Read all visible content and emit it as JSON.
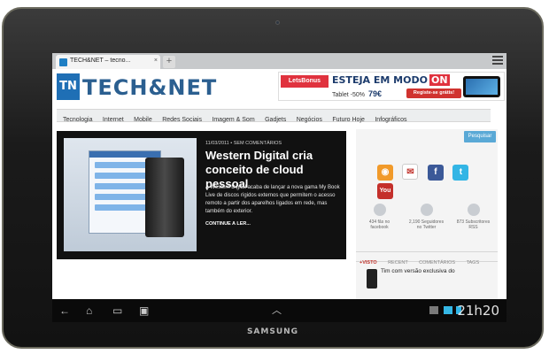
{
  "device": {
    "brand": "SAMSUNG"
  },
  "browser": {
    "tab_title": "TECH&NET – tecno...",
    "tab_close": "×",
    "new_tab": "+"
  },
  "site": {
    "logo_mark": "TN",
    "logo_text": "TECH&NET",
    "ad": {
      "brand": "LetsBonus",
      "headline": "ESTEJA EM MODO",
      "headline_highlight": "ON",
      "offer": "Tablet -50%",
      "price": "79€",
      "cta": "Registe-se grátis!"
    },
    "nav": [
      "Tecnologia",
      "Internet",
      "Mobile",
      "Redes Sociais",
      "Imagem & Som",
      "Gadjets",
      "Negócios",
      "Futuro Hoje",
      "Infográficos"
    ],
    "featured": {
      "meta": "11/03/2011 • SEM COMENTÁRIOS",
      "title": "Western Digital cria conceito de cloud pessoal",
      "excerpt": "A Western Digital acaba de lançar a nova gama My Book Live de discos rígidos externos que permitem o acesso remoto a partir dos aparelhos ligados em rede, mas também do exterior.",
      "read_more": "CONTINUE A LER..."
    },
    "sidebar": {
      "search_label": "Pesquisar",
      "social_icons": [
        "rss-icon",
        "email-icon",
        "facebook-icon",
        "twitter-icon",
        "youtube-icon"
      ],
      "youtube_label": "You",
      "stats": [
        {
          "line1": "434 fãs no",
          "line2": "facebook"
        },
        {
          "line1": "2,190 Seguidores",
          "line2": "no Twitter"
        },
        {
          "line1": "873 Subscritores",
          "line2": "RSS"
        }
      ],
      "tabs": [
        "+VISTO",
        "RECENT",
        "COMENTÁRIOS",
        "TAGS"
      ],
      "post_title": "Tim com versão exclusiva do"
    }
  },
  "system": {
    "time": "21h20"
  },
  "colors": {
    "accent": "#1f6fb5",
    "brand_red": "#e0323e",
    "search": "#5aa9d6"
  }
}
